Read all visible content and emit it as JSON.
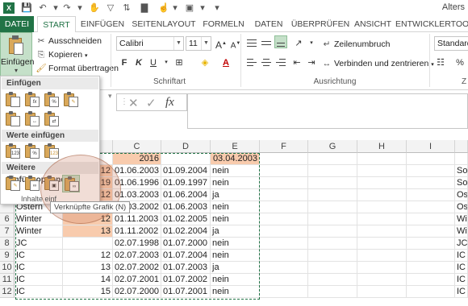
{
  "window": {
    "title": "Alters"
  },
  "tabs": [
    {
      "label": "DATEI"
    },
    {
      "label": "START"
    },
    {
      "label": "EINFÜGEN"
    },
    {
      "label": "SEITENLAYOUT"
    },
    {
      "label": "FORMELN"
    },
    {
      "label": "DATEN"
    },
    {
      "label": "ÜBERPRÜFEN"
    },
    {
      "label": "ANSICHT"
    },
    {
      "label": "ENTWICKLERTOOLS"
    }
  ],
  "clipboard": {
    "paste_label": "Einfügen",
    "cut": "Ausschneiden",
    "copy": "Kopieren",
    "format_painter": "Format übertragen"
  },
  "font": {
    "name": "Calibri",
    "size": "11",
    "bold": "F",
    "italic": "K",
    "underline": "U",
    "group_label": "Schriftart"
  },
  "alignment": {
    "wrap": "Zeilenumbruch",
    "merge": "Verbinden und zentrieren",
    "group_label": "Ausrichtung"
  },
  "number": {
    "format": "Standard"
  },
  "paste_menu": {
    "section1": "Einfügen",
    "section2": "Werte einfügen",
    "section3": "Weitere Einfügeoptionen",
    "inhalte_label": "Inhalte einf",
    "tooltip": "Verknüpfte Grafik (N)"
  },
  "grid": {
    "columns": [
      "C",
      "D",
      "E",
      "F",
      "G",
      "H",
      "I"
    ],
    "rows": [
      {
        "num": "",
        "a": "",
        "b": "",
        "c": "2016",
        "d": "",
        "e": "03.04.2003",
        "j": ""
      },
      {
        "num": "",
        "a": "",
        "b": "12",
        "c": "01.06.2003",
        "d": "01.09.2004",
        "e": "nein",
        "j": "Son"
      },
      {
        "num": "",
        "a": "",
        "b": "19",
        "c": "01.06.1996",
        "d": "01.09.1997",
        "e": "nein",
        "j": "Son"
      },
      {
        "num": "",
        "a": "",
        "b": "12",
        "c": "01.03.2003",
        "d": "01.06.2004",
        "e": "ja",
        "j": "Ost"
      },
      {
        "num": "",
        "a": "Ostern",
        "b": "12",
        "c": "01.03.2002",
        "d": "01.06.2003",
        "e": "nein",
        "j": "Ost"
      },
      {
        "num": "6",
        "a": "Winter",
        "b": "12",
        "c": "01.11.2003",
        "d": "01.02.2005",
        "e": "nein",
        "j": "Win"
      },
      {
        "num": "7",
        "a": "Winter",
        "b": "13",
        "c": "01.11.2002",
        "d": "01.02.2004",
        "e": "ja",
        "j": "Win"
      },
      {
        "num": "8",
        "a": "JC",
        "b": "",
        "c": "02.07.1998",
        "d": "01.07.2000",
        "e": "nein",
        "j": "JC"
      },
      {
        "num": "9",
        "a": "IC",
        "b": "12",
        "c": "02.07.2003",
        "d": "01.07.2004",
        "e": "nein",
        "j": "IC"
      },
      {
        "num": "10",
        "a": "IC",
        "b": "13",
        "c": "02.07.2002",
        "d": "01.07.2003",
        "e": "ja",
        "j": "IC"
      },
      {
        "num": "11",
        "a": "IC",
        "b": "14",
        "c": "02.07.2001",
        "d": "01.07.2002",
        "e": "nein",
        "j": "IC"
      },
      {
        "num": "12",
        "a": "IC",
        "b": "15",
        "c": "02.07.2000",
        "d": "01.07.2001",
        "e": "nein",
        "j": "IC"
      }
    ]
  },
  "colors": {
    "accent": "#217346",
    "orange_cell": "#f8cbad"
  }
}
